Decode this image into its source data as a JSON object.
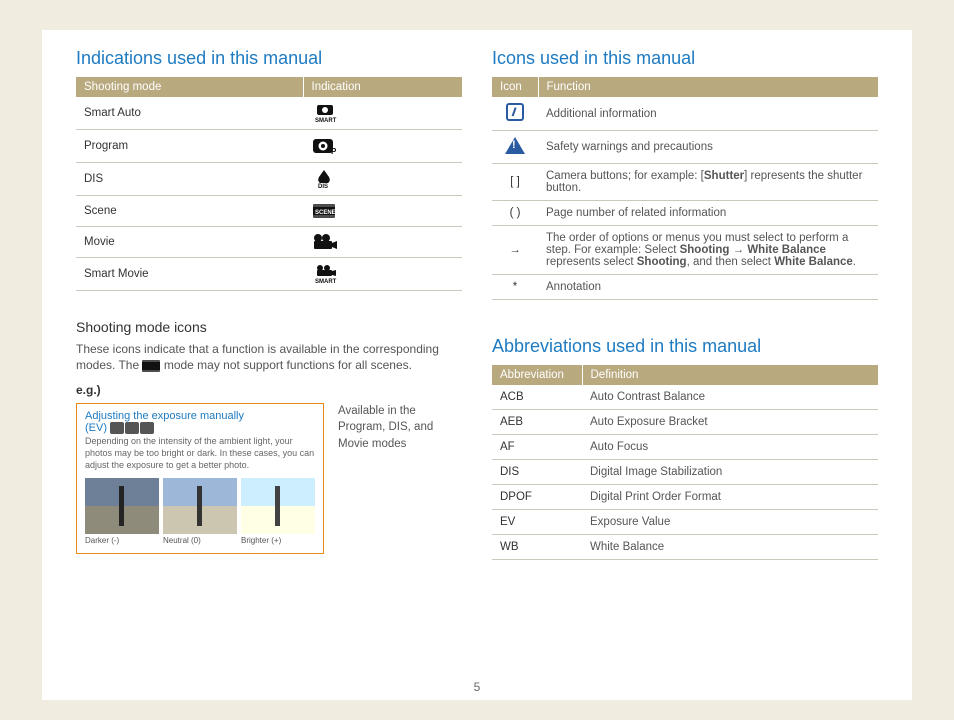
{
  "left": {
    "heading": "Indications used in this manual",
    "table": {
      "headers": [
        "Shooting mode",
        "Indication"
      ],
      "rows": [
        {
          "mode": "Smart Auto"
        },
        {
          "mode": "Program"
        },
        {
          "mode": "DIS"
        },
        {
          "mode": "Scene"
        },
        {
          "mode": "Movie"
        },
        {
          "mode": "Smart Movie"
        }
      ]
    },
    "sub_heading": "Shooting mode icons",
    "sub_desc_pre": "These icons indicate that a function is available in the corresponding modes. The ",
    "sub_desc_post": " mode may not support functions for all scenes.",
    "eg_label": "e.g.)",
    "example": {
      "title": "Adjusting the exposure manually",
      "ev": "(EV)",
      "desc": "Depending on the intensity of the ambient light, your photos may be too bright or dark. In these cases, you can adjust the exposure to get a better photo.",
      "thumbs": [
        "Darker (-)",
        "Neutral (0)",
        "Brighter (+)"
      ]
    },
    "callout": "Available in the Program, DIS, and Movie modes"
  },
  "right_top": {
    "heading": "Icons used in this manual",
    "headers": [
      "Icon",
      "Function"
    ],
    "rows": [
      {
        "icon": "info",
        "func": "Additional information"
      },
      {
        "icon": "warn",
        "func": "Safety warnings and precautions"
      },
      {
        "icon": "[ ]",
        "func_pre": "Camera buttons; for example: [",
        "func_bold": "Shutter",
        "func_post": "] represents the shutter button."
      },
      {
        "icon": "( )",
        "func": "Page number of related information"
      },
      {
        "icon": "→",
        "func_pre": "The order of options or menus you must select to perform a step. For example: Select ",
        "b1": "Shooting",
        "arrow": " → ",
        "b2": "White Balance",
        "mid": " represents select ",
        "b3": "Shooting",
        "mid2": ", and then select ",
        "b4": "White Balance",
        "end": "."
      },
      {
        "icon": "*",
        "func": "Annotation"
      }
    ]
  },
  "right_bottom": {
    "heading": "Abbreviations used in this manual",
    "headers": [
      "Abbreviation",
      "Definition"
    ],
    "rows": [
      {
        "abbr": "ACB",
        "def": "Auto Contrast Balance"
      },
      {
        "abbr": "AEB",
        "def": "Auto Exposure Bracket"
      },
      {
        "abbr": "AF",
        "def": "Auto Focus"
      },
      {
        "abbr": "DIS",
        "def": "Digital Image Stabilization"
      },
      {
        "abbr": "DPOF",
        "def": "Digital Print Order Format"
      },
      {
        "abbr": "EV",
        "def": "Exposure Value"
      },
      {
        "abbr": "WB",
        "def": "White Balance"
      }
    ]
  },
  "page_number": "5"
}
